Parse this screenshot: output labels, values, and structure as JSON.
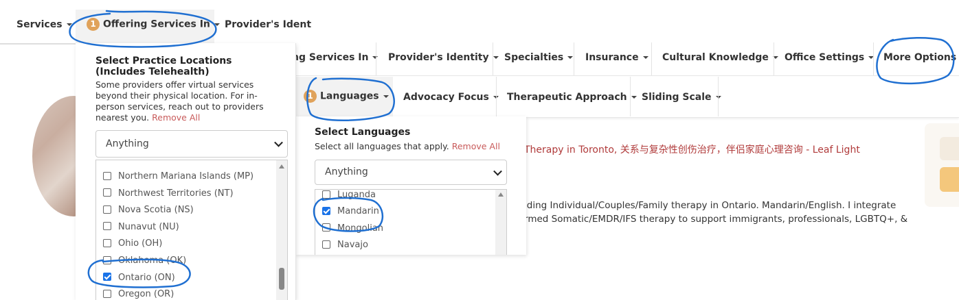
{
  "left_panel": {
    "nav": {
      "services_label": "Services",
      "offering_label": "Offering Services In",
      "offering_badge": "1",
      "identity_label": "Provider's Ident"
    },
    "dropdown": {
      "title": "Select Practice Locations (Includes Telehealth)",
      "description": "Some providers offer virtual services beyond their physical location. For in-person services, reach out to providers nearest you.",
      "remove_all": "Remove All",
      "select_value": "Anything",
      "items": [
        {
          "label": "Northern Mariana Islands (MP)",
          "checked": false
        },
        {
          "label": "Northwest Territories (NT)",
          "checked": false
        },
        {
          "label": "Nova Scotia (NS)",
          "checked": false
        },
        {
          "label": "Nunavut (NU)",
          "checked": false
        },
        {
          "label": "Ohio (OH)",
          "checked": false
        },
        {
          "label": "Oklahoma (OK)",
          "checked": false
        },
        {
          "label": "Ontario (ON)",
          "checked": true
        },
        {
          "label": "Oregon (OR)",
          "checked": false
        }
      ]
    }
  },
  "right_panel": {
    "nav_row1": {
      "offering_partial": "ng Services In",
      "identity": "Provider's Identity",
      "specialties": "Specialties",
      "insurance": "Insurance",
      "cultural": "Cultural Knowledge",
      "office": "Office Settings",
      "more": "More Options"
    },
    "nav_row2": {
      "languages_badge": "1",
      "languages": "Languages",
      "advocacy": "Advocacy Focus",
      "therapeutic": "Therapeutic Approach",
      "sliding": "Sliding Scale"
    },
    "languages_dropdown": {
      "title": "Select Languages",
      "description": "Select all languages that apply.",
      "remove_all": "Remove All",
      "select_value": "Anything",
      "items": [
        {
          "label": "Luganda",
          "checked": false
        },
        {
          "label": "Mandarin",
          "checked": true
        },
        {
          "label": "Mongolian",
          "checked": false
        },
        {
          "label": "Navajo",
          "checked": false
        }
      ]
    },
    "profile": {
      "headline": "Therapy in Toronto, 关系与复杂性创伤治疗，伴侣家庭心理咨询 - Leaf Light",
      "line1": "iding Individual/Couples/Family therapy in Ontario. Mandarin/English. I integrate",
      "line2": "rmed Somatic/EMDR/IFS therapy to support immigrants, professionals, LGBTQ+, &"
    }
  },
  "colors": {
    "accent_red": "#c85a5a",
    "badge_orange": "#e0a25a",
    "annotation_blue": "#1f6fd1",
    "checkbox_blue": "#1a73e8"
  }
}
